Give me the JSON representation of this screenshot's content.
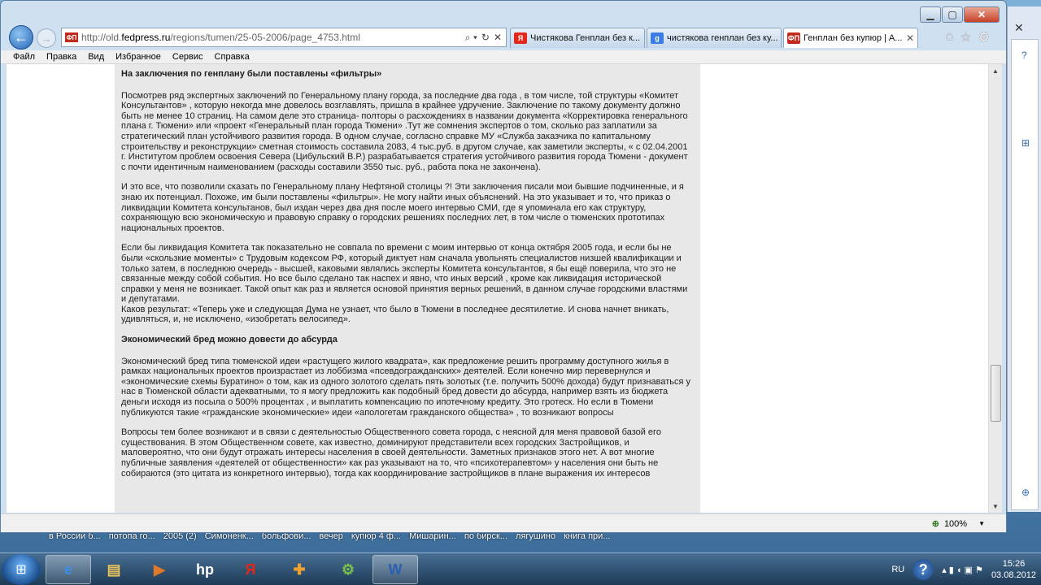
{
  "window": {
    "address": {
      "url_prefix": "http://old.",
      "url_host": "fedpress.ru",
      "url_path": "/regions/tumen/25-05-2006/page_4753.html",
      "favicon_text": "ФП",
      "search_icon": "⌕ ▾",
      "lock": "🔒",
      "refresh": "↻",
      "stop": "✕"
    },
    "tabs": [
      {
        "label": "Чистякова Генплан без к...",
        "icon_text": "Я",
        "icon_color": "#e3271b",
        "active": false
      },
      {
        "label": "чистякова генплан без ку...",
        "icon_text": "g",
        "icon_color": "#3b7de0",
        "active": false
      },
      {
        "label": "Генплан без купюр | А...",
        "icon_text": "ФП",
        "icon_color": "#c12a1c",
        "active": true
      }
    ],
    "tab_close": "✕",
    "menu": [
      "Файл",
      "Правка",
      "Вид",
      "Избранное",
      "Сервис",
      "Справка"
    ],
    "zoom": "100%",
    "zoom_dropdown": "▼"
  },
  "article": {
    "heading1": "На заключения по генплану были поставлены «фильтры»",
    "p1": "Посмотрев ряд экспертных заключений по Генеральному плану города, за последние два года , в том числе, той структуры «Комитет Консультантов» , которую некогда мне довелось возглавлять, пришла в крайнее удручение. Заключение по такому документу должно быть не менее 10 страниц. На самом деле это страница- полторы о расхождениях в названии документа «Корректировка генерального плана г. Тюмени» или «проект «Генеральный план города Тюмени» .Тут же сомнения экспертов о том, сколько раз заплатили за стратегический план устойчивого развития города. В одном случае, согласно справке МУ «Служба заказчика по капитальному строительству и реконструкции» сметная стоимость составила 2083, 4 тыс.руб. в другом случае, как заметили эксперты, « с 02.04.2001 г. Институтом проблем освоения Севера (Цибульский В.Р.) разрабатывается стратегия устойчивого развития города Тюмени - документ с почти идентичным наименованием (расходы составили 3550 тыс. руб., работа пока не закончена).",
    "p2": "И это все, что позволили сказать по Генеральному плану Нефтяной столицы ?! Эти заключения писали мои бывшие подчиненные, и я знаю их потенциал. Похоже, им были поставлены «фильтры». Не могу найти иных объяснений. На это указывает и то, что приказ о ликвидации Комитета консультанов, был издан через два дня после моего интервью СМИ, где я упоминала его как структуру, сохраняющую всю экономическую и правовую справку о городских решениях последних лет, в том числе о тюменских прототипах национальных проектов.",
    "p3": "Если бы ликвидация Комитета так показательно не совпала по времени с моим интервью от конца октября 2005 года, и если бы не были «скользкие моменты» с Трудовым кодексом РФ, который диктует нам сначала увольнять специалистов низшей квалификации и только затем, в последнюю очередь - высшей, каковыми являлись эксперты Комитета консультантов, я бы ещё поверила, что это не связанные между собой события. Но все было сделано так наспех и явно, что иных версий , кроме как ликвидация исторической справки у меня не возникает. Такой опыт как раз и является основой принятия верных решений, в данном случае городскими властями и депутатами.",
    "p4": "Каков результат: «Теперь уже и следующая Дума не узнает, что было в Тюмени в последнее десятилетие. И снова начнет вникать, удивляться, и, не исключено, «изобретать велосипед».",
    "heading2": "Экономический бред можно довести до абсурда",
    "p5": "Экономический бред типа тюменской идеи «растущего жилого квадрата», как предложение решить программу доступного жилья в рамках национальных проектов произрастает из лоббизма «псевдогражданских» деятелей. Если конечно мир перевернулся и «экономические схемы Буратино» о том, как из одного золотого сделать пять золотых (т.е. получить 500% дохода) будут признаваться у нас в Тюменской области адекватными, то я могу предложить как подобный бред довести до абсурда, например взять из бюджета деньги исходя из посыла о 500% процентах , и выплатить компенсацию по ипотечному кредиту. Это гротеск. Но если в Тюмени публикуются такие «гражданские экономические» идеи «апологетам гражданского общества» , то возникают вопросы",
    "p6": "Вопросы тем более возникают и в связи с деятельностью Общественного совета города, с неясной для меня правовой базой его существования. В этом Общественном совете, как известно, доминируют представители всех городских Застройщиков, и маловероятно, что они будут отражать интересы населения в своей деятельности. Заметных признаков этого нет. А вот многие публичные заявления «деятелей от общественности» как раз указывают на то, что «психотерапевтом» у населения они быть не собираются (это цитата из конкретного интервью), тогда как координирование застройщиков в плане выражения их интересов"
  },
  "desktop": {
    "labels": [
      "в России б...",
      "потопа го...",
      "2005 (2)",
      "Симоненк...",
      "больфови...",
      "вечер",
      "купюр 4 ф...",
      "Мишарин...",
      "по бирск...",
      "лягушино",
      "книга при..."
    ]
  },
  "taskbar": {
    "start": "⊞",
    "apps": [
      {
        "name": "ie",
        "glyph": "e",
        "color": "#3a8ee6",
        "active": true
      },
      {
        "name": "explorer",
        "glyph": "▤",
        "color": "#e8c35a",
        "active": false
      },
      {
        "name": "media",
        "glyph": "▶",
        "color": "#e07a2a",
        "active": false
      },
      {
        "name": "hp",
        "glyph": "hp",
        "color": "#ffffff",
        "active": false
      },
      {
        "name": "yandex",
        "glyph": "Я",
        "color": "#e3271b",
        "active": false
      },
      {
        "name": "puzzle",
        "glyph": "✚",
        "color": "#f0a030",
        "active": false
      },
      {
        "name": "network",
        "glyph": "⚙",
        "color": "#7ac04a",
        "active": false
      },
      {
        "name": "word",
        "glyph": "W",
        "color": "#2b5fb0",
        "active": true
      }
    ],
    "lang": "RU",
    "help": "?",
    "time": "15:26",
    "date": "03.08.2012"
  },
  "background_window": {
    "close": "✕",
    "symbols": [
      "?",
      "⊞",
      "⊕"
    ]
  }
}
